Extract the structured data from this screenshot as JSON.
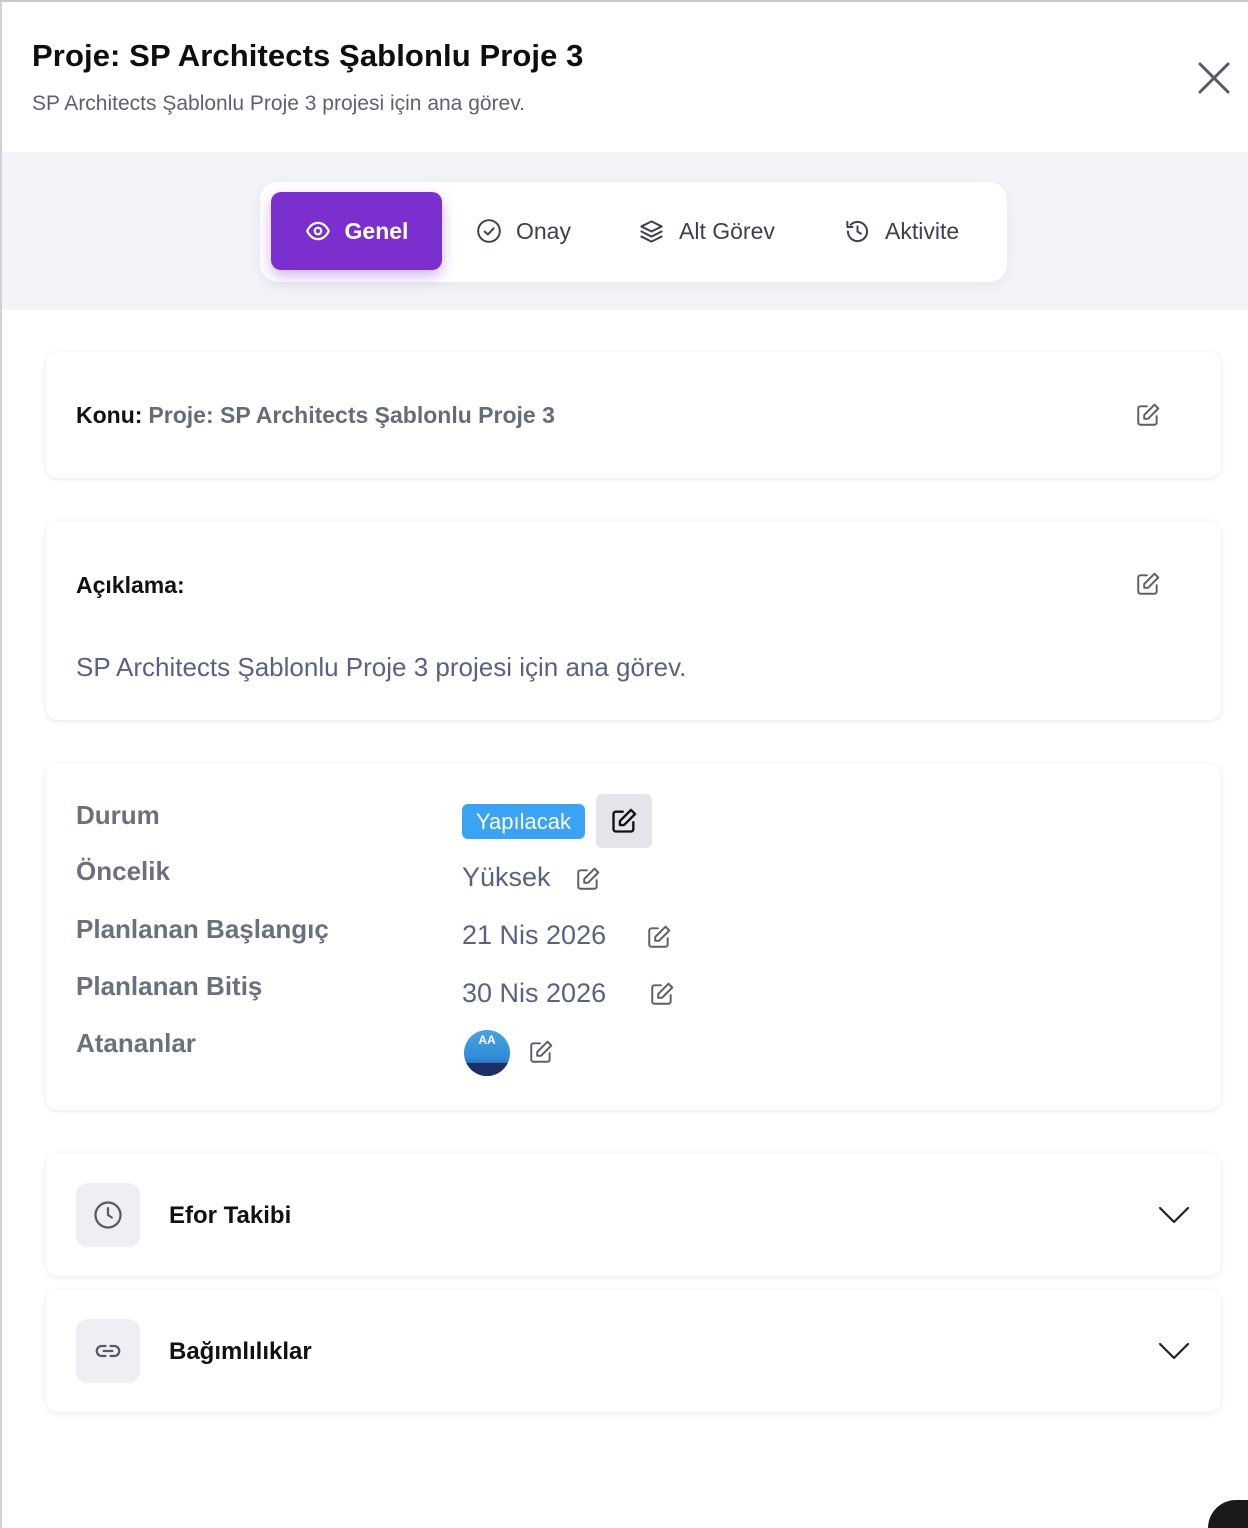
{
  "header": {
    "title": "Proje: SP Architects Şablonlu Proje 3",
    "subtitle": "SP Architects Şablonlu Proje 3 projesi için ana görev."
  },
  "tabs": [
    {
      "label": "Genel",
      "icon": "eye-icon",
      "active": true
    },
    {
      "label": "Onay",
      "icon": "check-circle-icon",
      "active": false
    },
    {
      "label": "Alt Görev",
      "icon": "layers-icon",
      "active": false
    },
    {
      "label": "Aktivite",
      "icon": "history-icon",
      "active": false
    }
  ],
  "konu": {
    "label": "Konu:",
    "value": "Proje: SP Architects Şablonlu Proje 3"
  },
  "aciklama": {
    "label": "Açıklama:",
    "text": "SP Architects Şablonlu Proje 3 projesi için ana görev."
  },
  "details": {
    "durum": {
      "label": "Durum",
      "value": "Yapılacak"
    },
    "oncelik": {
      "label": "Öncelik",
      "value": "Yüksek"
    },
    "baslangic": {
      "label": "Planlanan Başlangıç",
      "value": "21 Nis 2026"
    },
    "bitis": {
      "label": "Planlanan Bitiş",
      "value": "30 Nis 2026"
    },
    "atananlar": {
      "label": "Atananlar",
      "avatar_initials": "AA"
    }
  },
  "accordions": [
    {
      "title": "Efor Takibi",
      "icon": "clock-icon"
    },
    {
      "title": "Bağımlılıklar",
      "icon": "link-icon"
    }
  ],
  "colors": {
    "accent": "#7b2fcf",
    "status_badge": "#3aa3f3",
    "muted_text": "#5b6182"
  }
}
